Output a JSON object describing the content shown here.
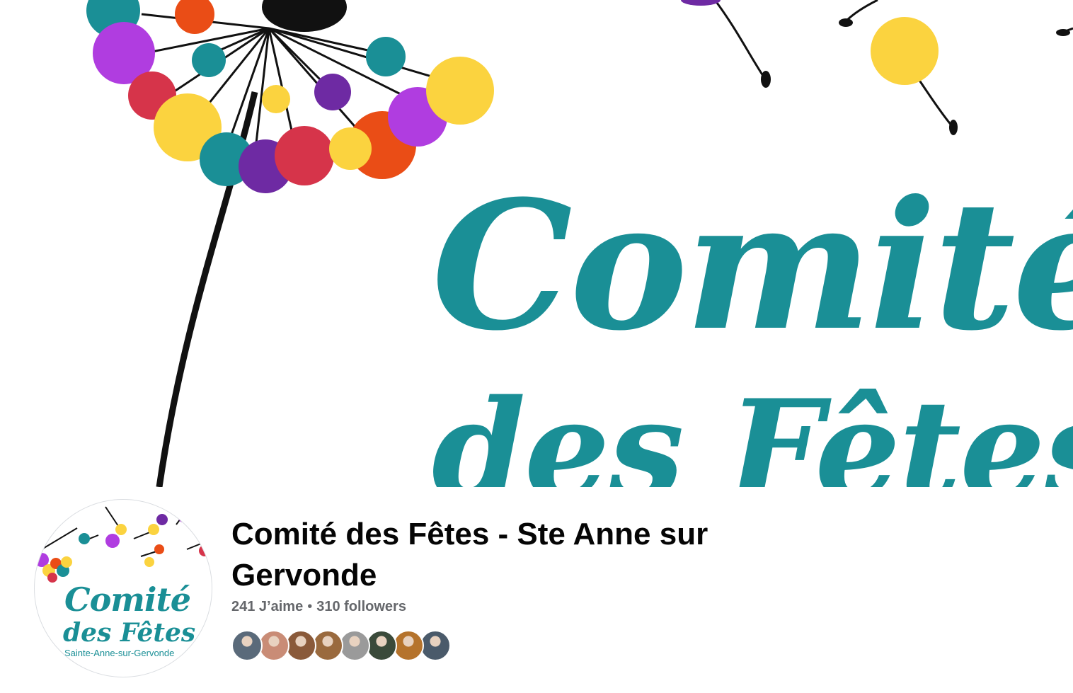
{
  "cover": {
    "title_line1": "Comité",
    "title_line2": "des Fêtes",
    "colors": {
      "teal": "#1a8f96",
      "purple": "#b03de0",
      "yellow": "#fbd33f",
      "orange": "#ea4d16",
      "red": "#d6344a",
      "dark_purple": "#6e2aa3",
      "stem": "#111111"
    }
  },
  "profile_picture": {
    "line1": "Comité",
    "line2": "des Fêtes",
    "line3": "Sainte-Anne-sur-Gervonde"
  },
  "page": {
    "name": "Comité des Fêtes - Ste Anne sur Gervonde",
    "likes": "241 J’aime",
    "separator": "•",
    "followers": "310 followers"
  },
  "follower_avatars": [
    {
      "label": "follower-1",
      "color": "#5a6a7a"
    },
    {
      "label": "follower-2",
      "color": "#c98c76"
    },
    {
      "label": "follower-3",
      "color": "#8a5a3a"
    },
    {
      "label": "follower-4",
      "color": "#9a6a3e"
    },
    {
      "label": "follower-5",
      "color": "#9a9a9a"
    },
    {
      "label": "follower-6",
      "color": "#3a4a3a"
    },
    {
      "label": "follower-7",
      "color": "#b5732c"
    },
    {
      "label": "follower-8",
      "color": "#4a5a6a"
    }
  ]
}
